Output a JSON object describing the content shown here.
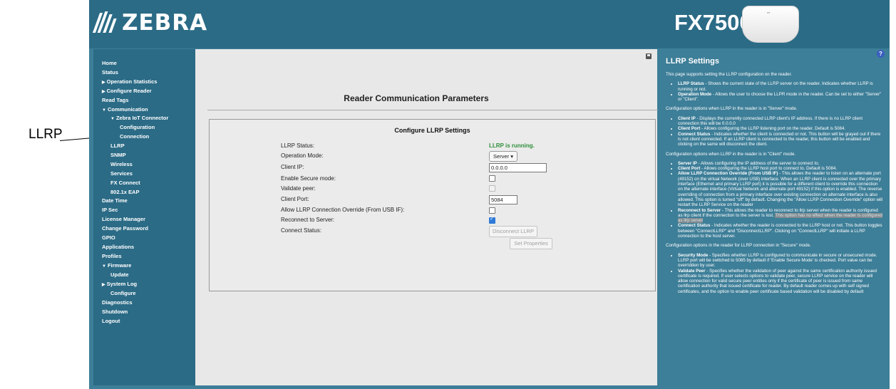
{
  "callout": {
    "label": "LLRP"
  },
  "header": {
    "brand": "ZEBRA",
    "model": "FX7500",
    "device_badge": "′″"
  },
  "sidebar": {
    "items": [
      {
        "label": "Home"
      },
      {
        "label": "Status"
      },
      {
        "label": "Operation Statistics",
        "arrow": "▶"
      },
      {
        "label": "Configure Reader",
        "arrow": "▶"
      },
      {
        "label": "Read Tags"
      },
      {
        "label": "Communication",
        "arrow": "▼"
      },
      {
        "label": "Zebra IoT Connector",
        "arrow": "▼"
      },
      {
        "label": "Configuration"
      },
      {
        "label": "Connection"
      },
      {
        "label": "LLRP"
      },
      {
        "label": "SNMP"
      },
      {
        "label": "Wireless"
      },
      {
        "label": "Services"
      },
      {
        "label": "FX Connect"
      },
      {
        "label": "802.1x EAP"
      },
      {
        "label": "Date Time"
      },
      {
        "label": "IP Sec"
      },
      {
        "label": "License Manager"
      },
      {
        "label": "Change Password"
      },
      {
        "label": "GPIO"
      },
      {
        "label": "Applications"
      },
      {
        "label": "Profiles"
      },
      {
        "label": "Firmware",
        "arrow": "▼"
      },
      {
        "label": "Update"
      },
      {
        "label": "System Log",
        "arrow": "▶"
      },
      {
        "label": "Configure"
      },
      {
        "label": "Diagnostics"
      },
      {
        "label": "Shutdown"
      },
      {
        "label": "Logout"
      }
    ]
  },
  "main": {
    "page_title": "Reader Communication Parameters",
    "panel_title": "Configure LLRP Settings",
    "labels": {
      "llrp_status": "LLRP Status:",
      "operation_mode": "Operation Mode:",
      "client_ip": "Client IP:",
      "secure_mode": "Enable Secure mode:",
      "validate_peer": "Validate peer:",
      "client_port": "Client Port:",
      "allow_override": "Allow LLRP Connection Override (From USB IF):",
      "reconnect": "Reconnect to Server:",
      "connect_status": "Connect Status:"
    },
    "values": {
      "llrp_status": "LLRP is running.",
      "operation_mode": "Server ▾",
      "client_ip": "0.0.0.0",
      "client_port": "5084",
      "secure_mode_checked": false,
      "validate_peer_checked": false,
      "allow_override_checked": false,
      "reconnect_checked": true
    },
    "buttons": {
      "disconnect": "Disconnect LLRP",
      "set_properties": "Set Properties"
    }
  },
  "help": {
    "icon": "?",
    "title": "LLRP Settings",
    "intro": "This page supports setting the LLRP configuration on the reader.",
    "list1": [
      {
        "term": "LLRP Status",
        "text": " - Shows the current state of the LLRP server on the reader. Indicates whether LLRP is running or not."
      },
      {
        "term": "Operation Mode",
        "text": " - Allows the user to choose the LLPR mode in the reader. Can be set to either \"Server\" or \"Client\"."
      }
    ],
    "server_heading": "Configuration options when LLRP in the reader is in \"Server\" mode.",
    "list2": [
      {
        "term": "Client IP",
        "text": " - Displays the currently connected LLRP client's IP address. If there is no LLRP client connection this will be 0.0.0.0"
      },
      {
        "term": "Client Port",
        "text": " - Allows configuring the LLRP listening port on the reader. Default is 5084."
      },
      {
        "term": "Connect Status",
        "text": " - Indicates whether the client is connected or not. This button will be grayed out if there is not client connected. If an LLRP client is connected to the reader, this button will be enabled and clicking on the same will disconnect the client."
      }
    ],
    "client_heading": "Configuration options when LLRP in the reader is in \"Client\" mode.",
    "list3": [
      {
        "term": "Server IP",
        "text": " - Allows configuring the IP address of the server to connect to."
      },
      {
        "term": "Client Port",
        "text": " - Allows configuring the LLRP host port to connect to. Default is 5084."
      },
      {
        "term": "Allow LLRP Connection Override (From USB IF)",
        "text": " - This allows the reader to listen on an alternate port (49152) on the virtual Network (over USB) interface. When an LLRP client is connected over the primary interface (Ethernet and primary LLRP port) it is possible for a different client to override this connection on the alternate interface (Virtual Network and alternate port 49152) if this option is enabled. The reverse overriding of connection from a primary interface over existing connection on alternate interface is also allowed. This option is turned \"off\" by default. Changing the \"Allow LLRP Connection Override\" option will restart the LLRP Service on the reader"
      },
      {
        "term": "Reconnect to Server",
        "text": " - This allows the reader to reconnect to llrp server when the reader is configured as llrp client if the connection to the server is lost. ",
        "highlight": "This option has no effect when the reader is configured as llrp server"
      },
      {
        "term": "Connect Status",
        "text": " - Indicates whether the reader is connected to the LLRP host or not. This button toggles between \"ConnectLLRP\" and \"DisconnectLLRP\". Clicking on \"ConnectLLRP\" will initiate a LLRP connection to the host server."
      }
    ],
    "secure_heading": "Configuration options in the reader for LLRP connection in \"Secure\" mode.",
    "list4": [
      {
        "term": "Security Mode",
        "text": " - Specifies whether LLRP is configured to communicate in secure or unsecured mode. LLRP port will be switched to 5085 by default if 'Enable Secure Mode' is checked. Port value can be overridden by user."
      },
      {
        "term": "Validate Peer",
        "text": " - Specifies whether the validation of peer against the same certification authority issued certificate is required. If user selects options to validate peer, secure LLRP service on the reader will allow connection for valid secure peer entities only if the certificate of peer is issued from same certification authority that issued certificate for reader. By default reader comes up with self signed certificates, and the option to enable peer certificate based validation will be disabled by default"
      }
    ]
  }
}
